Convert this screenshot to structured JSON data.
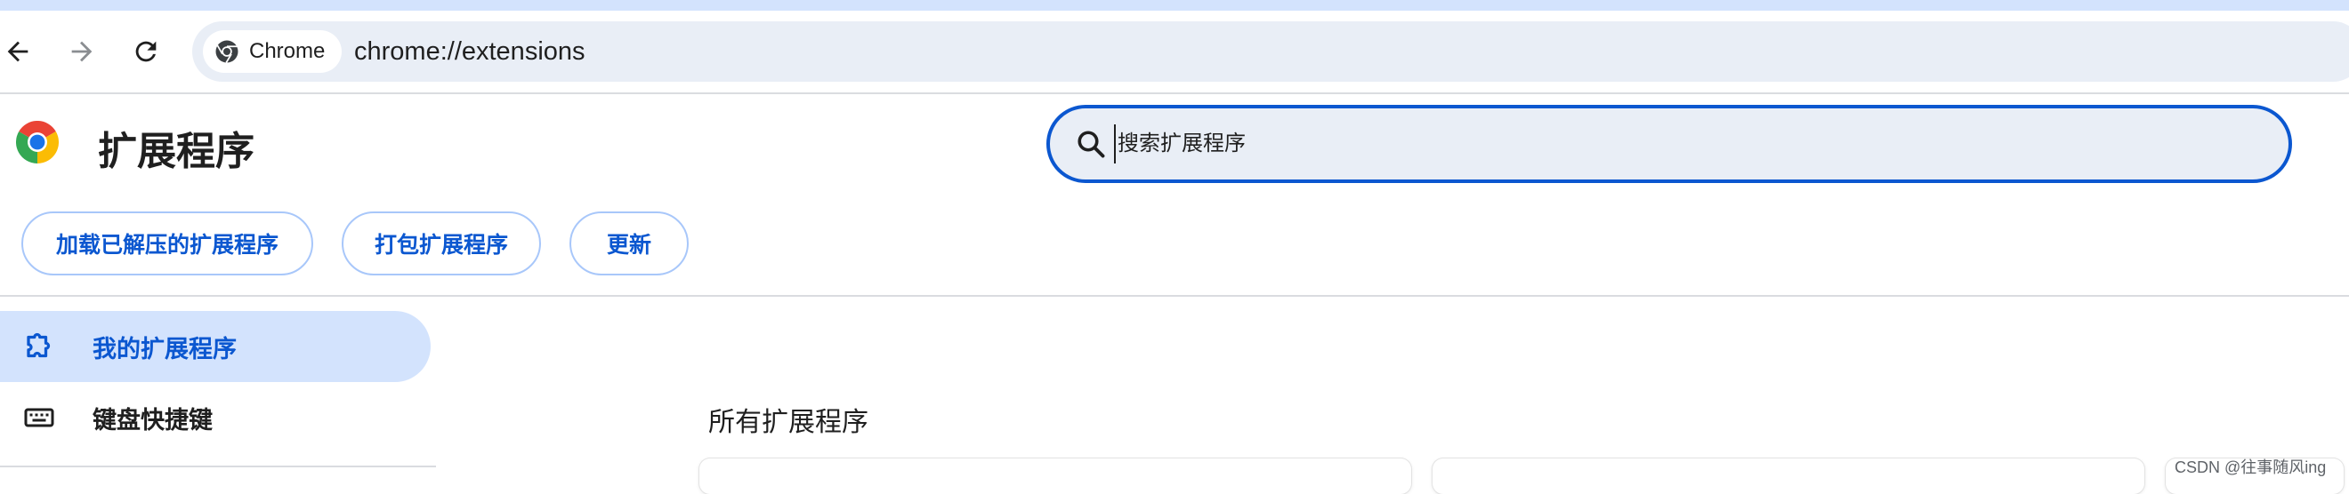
{
  "browser": {
    "chip_label": "Chrome",
    "url": "chrome://extensions"
  },
  "header": {
    "title": "扩展程序",
    "search_placeholder": "搜索扩展程序"
  },
  "actions": {
    "load_unpacked": "加载已解压的扩展程序",
    "pack": "打包扩展程序",
    "update": "更新"
  },
  "sidebar": {
    "items": [
      {
        "label": "我的扩展程序",
        "icon": "puzzle-icon",
        "active": true
      },
      {
        "label": "键盘快捷键",
        "icon": "keyboard-icon",
        "active": false
      }
    ]
  },
  "main": {
    "section_title": "所有扩展程序"
  },
  "watermark": "CSDN @往事随风ing",
  "colors": {
    "accent": "#0b57d0",
    "active_bg": "#d3e3fd",
    "omnibox_bg": "#e9eef6",
    "pill_border": "#a8c7fa"
  }
}
